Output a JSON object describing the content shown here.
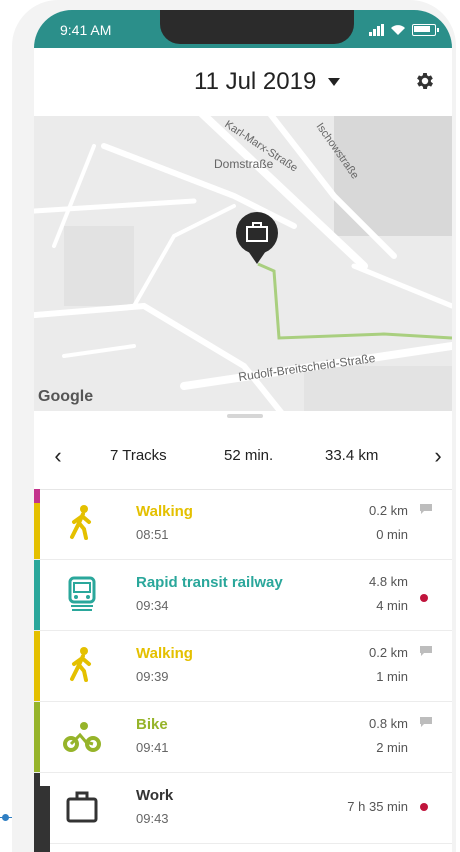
{
  "status_bar": {
    "time": "9:41 AM"
  },
  "header": {
    "date": "11 Jul 2019"
  },
  "map": {
    "streets": [
      "Karl-Marx-Straße",
      "Domstraße",
      "Ischowstraße",
      "Rudolf-Breitscheid-Straße"
    ],
    "attribution": "Google",
    "marker_icon": "briefcase-icon",
    "route_color": "#a9cf7f"
  },
  "summary": {
    "tracks": "7 Tracks",
    "duration": "52 min.",
    "distance": "33.4 km"
  },
  "tracks": [
    {
      "title": "Walking",
      "time": "08:51",
      "distance": "0.2 km",
      "duration": "0 min",
      "color": "#e4c000",
      "icon": "walking-icon",
      "indicator": "comment"
    },
    {
      "title": "Rapid transit railway",
      "time": "09:34",
      "distance": "4.8 km",
      "duration": "4 min",
      "color": "#2aa79b",
      "icon": "train-icon",
      "indicator": "dot"
    },
    {
      "title": "Walking",
      "time": "09:39",
      "distance": "0.2 km",
      "duration": "1 min",
      "color": "#e4c000",
      "icon": "walking-icon",
      "indicator": "comment"
    },
    {
      "title": "Bike",
      "time": "09:41",
      "distance": "0.8 km",
      "duration": "2 min",
      "color": "#96b42a",
      "icon": "bike-icon",
      "indicator": "comment"
    },
    {
      "title": "Work",
      "time": "09:43",
      "distance": "",
      "duration": "7 h 35 min",
      "color": "#333333",
      "icon": "briefcase-icon",
      "indicator": "dot"
    }
  ]
}
